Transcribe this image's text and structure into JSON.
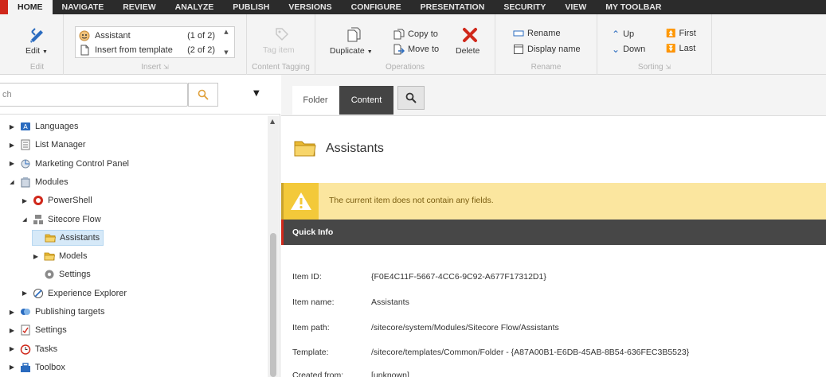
{
  "nav": {
    "tabs": [
      "HOME",
      "NAVIGATE",
      "REVIEW",
      "ANALYZE",
      "PUBLISH",
      "VERSIONS",
      "CONFIGURE",
      "PRESENTATION",
      "SECURITY",
      "VIEW",
      "MY TOOLBAR"
    ],
    "active": "HOME"
  },
  "ribbon": {
    "edit": {
      "label": "Edit",
      "group": "Edit"
    },
    "insert": {
      "items": [
        {
          "label": "Assistant",
          "count": "(1 of 2)"
        },
        {
          "label": "Insert from template",
          "count": "(2 of 2)"
        }
      ],
      "group": "Insert"
    },
    "tagging": {
      "label": "Tag item",
      "group": "Content Tagging"
    },
    "operations": {
      "duplicate": "Duplicate",
      "copy_to": "Copy to",
      "move_to": "Move to",
      "delete": "Delete",
      "group": "Operations"
    },
    "rename": {
      "rename": "Rename",
      "display_name": "Display name",
      "group": "Rename"
    },
    "sorting": {
      "up": "Up",
      "down": "Down",
      "first": "First",
      "last": "Last",
      "group": "Sorting"
    }
  },
  "search": {
    "value": "ch"
  },
  "tree": [
    {
      "label": "Languages",
      "indent": 0,
      "arrow": "▶",
      "icon": "languages-icon"
    },
    {
      "label": "List Manager",
      "indent": 0,
      "arrow": "▶",
      "icon": "list-icon"
    },
    {
      "label": "Marketing Control Panel",
      "indent": 0,
      "arrow": "▶",
      "icon": "marketing-icon"
    },
    {
      "label": "Modules",
      "indent": 0,
      "arrow": "◢",
      "icon": "modules-icon"
    },
    {
      "label": "PowerShell",
      "indent": 1,
      "arrow": "▶",
      "icon": "powershell-icon"
    },
    {
      "label": "Sitecore Flow",
      "indent": 1,
      "arrow": "◢",
      "icon": "flow-icon"
    },
    {
      "label": "Assistants",
      "indent": 2,
      "arrow": "",
      "icon": "folder-icon",
      "selected": true
    },
    {
      "label": "Models",
      "indent": 2,
      "arrow": "▶",
      "icon": "folder-icon"
    },
    {
      "label": "Settings",
      "indent": 2,
      "arrow": "",
      "icon": "settings-gear-icon"
    },
    {
      "label": "Experience Explorer",
      "indent": 1,
      "arrow": "▶",
      "icon": "explorer-icon"
    },
    {
      "label": "Publishing targets",
      "indent": 0,
      "arrow": "▶",
      "icon": "publishing-icon"
    },
    {
      "label": "Settings",
      "indent": 0,
      "arrow": "▶",
      "icon": "settings-icon"
    },
    {
      "label": "Tasks",
      "indent": 0,
      "arrow": "▶",
      "icon": "tasks-icon"
    },
    {
      "label": "Toolbox",
      "indent": 0,
      "arrow": "▶",
      "icon": "toolbox-icon"
    }
  ],
  "editor": {
    "tabs": {
      "folder": "Folder",
      "content": "Content"
    },
    "title": "Assistants",
    "warning": "The current item does not contain any fields.",
    "quick_info_title": "Quick Info",
    "info": [
      {
        "key": "Item ID:",
        "value": "{F0E4C11F-5667-4CC6-9C92-A677F17312D1}"
      },
      {
        "key": "Item name:",
        "value": "Assistants"
      },
      {
        "key": "Item path:",
        "value": "/sitecore/system/Modules/Sitecore Flow/Assistants"
      },
      {
        "key": "Template:",
        "value": "/sitecore/templates/Common/Folder - {A87A00B1-E6DB-45AB-8B54-636FEC3B5523}"
      },
      {
        "key": "Created from:",
        "value": "[unknown]"
      }
    ]
  },
  "colors": {
    "brand_red": "#d0281b",
    "nav_bg": "#2b2b2b",
    "warning_bg": "#fbe69f",
    "selected_bg": "#d6e9f8"
  }
}
